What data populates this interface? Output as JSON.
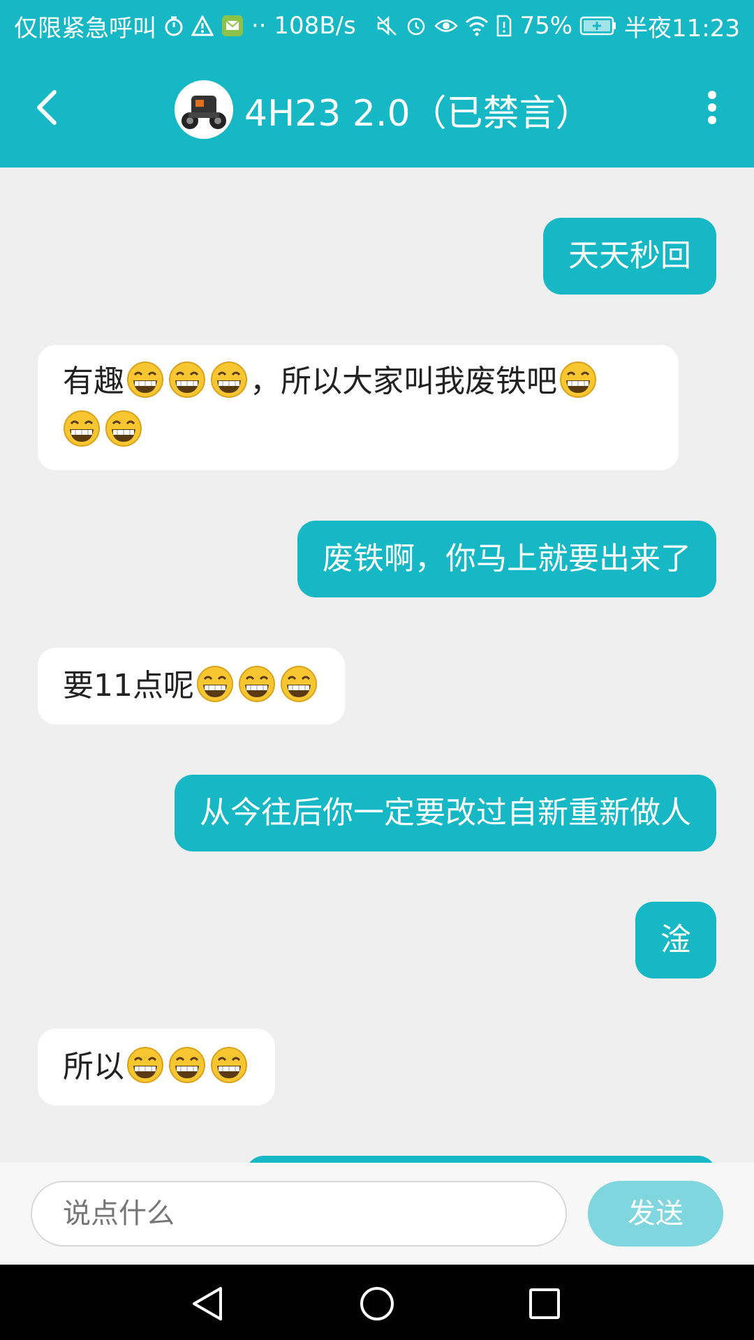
{
  "status_bar": {
    "left_text": "仅限紧急呼叫",
    "speed": "·· 108B/s",
    "battery": "75%",
    "time": "半夜11:23",
    "icons": [
      "timer-icon",
      "warning-icon",
      "message-icon",
      "mute-icon",
      "alarm-icon",
      "eye-icon",
      "wifi-icon",
      "sim-icon",
      "battery-icon"
    ]
  },
  "header": {
    "title": "4H23 2.0（已禁言）",
    "icons": [
      "back-arrow-icon",
      "avatar",
      "more-vertical-icon"
    ]
  },
  "messages": [
    {
      "side": "me",
      "text": "天天秒回",
      "emoji_count": 0
    },
    {
      "side": "other",
      "line1": "有趣",
      "line1_emoji": 3,
      "line1_tail": "，所以大家叫我废铁吧",
      "line2_emoji": 2
    },
    {
      "side": "me",
      "text": "废铁啊，你马上就要出来了"
    },
    {
      "side": "other",
      "text": "要11点呢",
      "emoji_count": 3
    },
    {
      "side": "me",
      "text": "从今往后你一定要改过自新重新做人"
    },
    {
      "side": "me",
      "text": "淦"
    },
    {
      "side": "other",
      "text": "所以",
      "emoji_count": 3
    }
  ],
  "input": {
    "placeholder": "说点什么",
    "send_label": "发送"
  },
  "colors": {
    "accent": "#16b8c6",
    "send_disabled": "#7fd6de",
    "background": "#efefef"
  }
}
